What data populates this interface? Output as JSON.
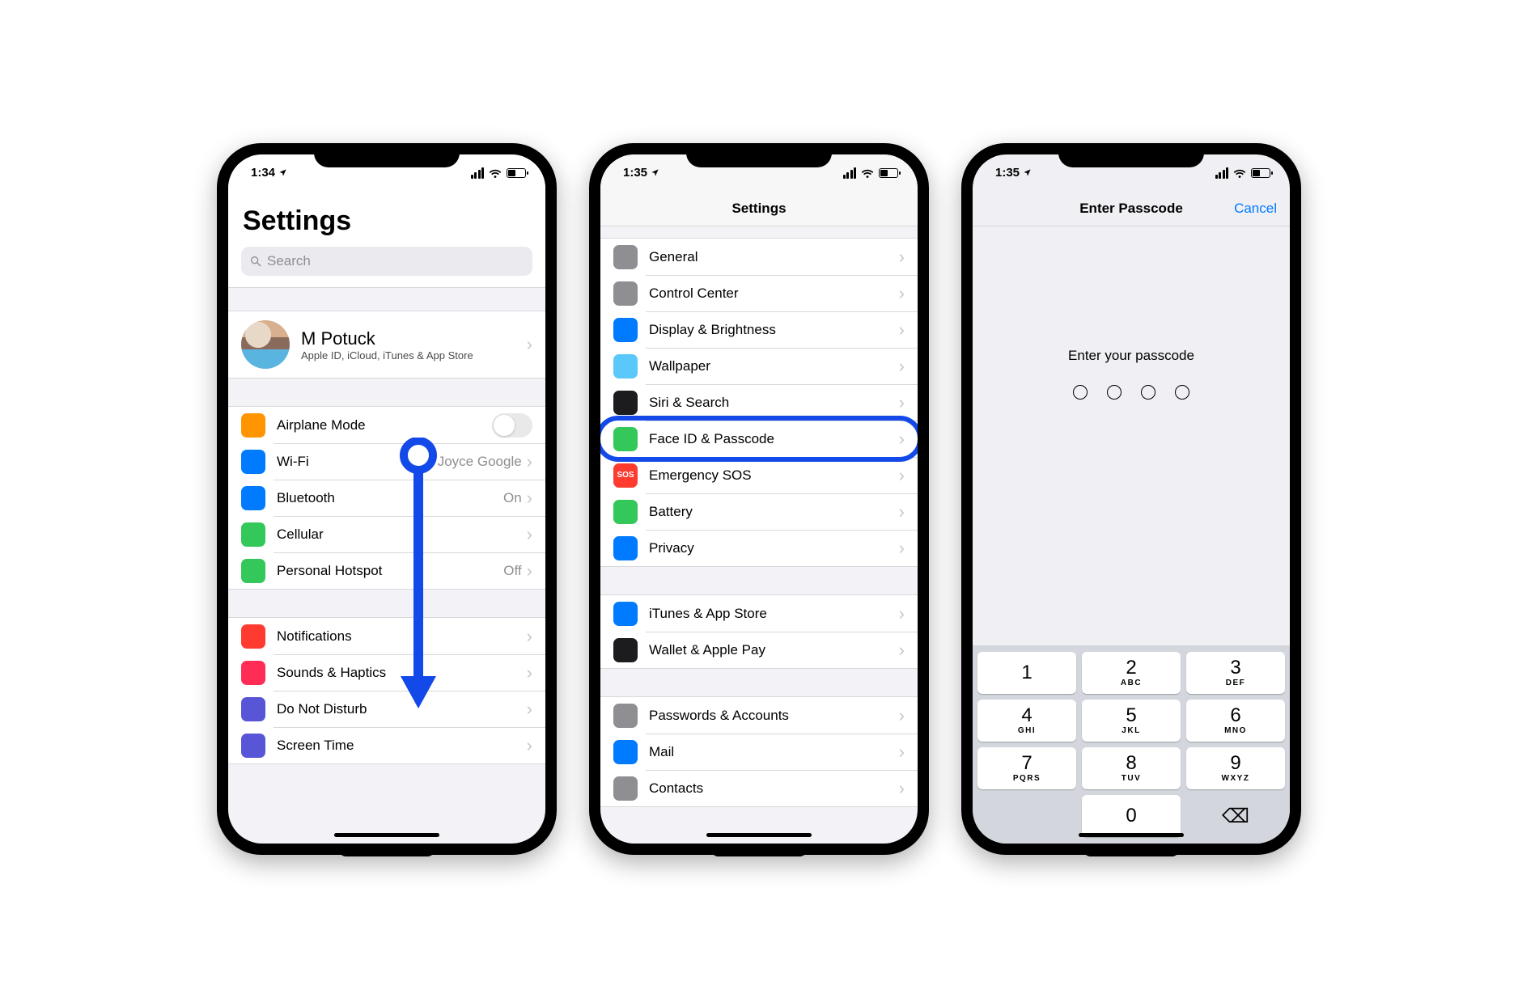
{
  "screen1": {
    "time": "1:34",
    "title": "Settings",
    "search_placeholder": "Search",
    "profile": {
      "name": "M Potuck",
      "subtitle": "Apple ID, iCloud, iTunes & App Store"
    },
    "rows_a": [
      {
        "label": "Airplane Mode",
        "toggle": true,
        "icon": "airplane-icon",
        "color": "ic-orange"
      },
      {
        "label": "Wi-Fi",
        "value": "Joyce Google",
        "icon": "wifi-icon",
        "color": "ic-blue"
      },
      {
        "label": "Bluetooth",
        "value": "On",
        "icon": "bluetooth-icon",
        "color": "ic-blue"
      },
      {
        "label": "Cellular",
        "value": "",
        "icon": "cellular-icon",
        "color": "ic-green"
      },
      {
        "label": "Personal Hotspot",
        "value": "Off",
        "icon": "hotspot-icon",
        "color": "ic-green"
      }
    ],
    "rows_b": [
      {
        "label": "Notifications",
        "icon": "notifications-icon",
        "color": "ic-red"
      },
      {
        "label": "Sounds & Haptics",
        "icon": "sounds-icon",
        "color": "ic-pink"
      },
      {
        "label": "Do Not Disturb",
        "icon": "dnd-icon",
        "color": "ic-purple"
      },
      {
        "label": "Screen Time",
        "icon": "screentime-icon",
        "color": "ic-purple"
      }
    ]
  },
  "screen2": {
    "time": "1:35",
    "title": "Settings",
    "rows_a": [
      {
        "label": "General",
        "icon": "gear-icon",
        "color": "ic-gray"
      },
      {
        "label": "Control Center",
        "icon": "control-center-icon",
        "color": "ic-gray"
      },
      {
        "label": "Display & Brightness",
        "icon": "display-icon",
        "color": "ic-blue"
      },
      {
        "label": "Wallpaper",
        "icon": "wallpaper-icon",
        "color": "ic-lblue"
      },
      {
        "label": "Siri & Search",
        "icon": "siri-icon",
        "color": "ic-dark"
      },
      {
        "label": "Face ID & Passcode",
        "icon": "faceid-icon",
        "color": "ic-green",
        "highlighted": true
      },
      {
        "label": "Emergency SOS",
        "icon": "sos-icon",
        "color": "ic-red",
        "glyph": "SOS"
      },
      {
        "label": "Battery",
        "icon": "battery-icon",
        "color": "ic-green"
      },
      {
        "label": "Privacy",
        "icon": "privacy-icon",
        "color": "ic-blue"
      }
    ],
    "rows_b": [
      {
        "label": "iTunes & App Store",
        "icon": "appstore-icon",
        "color": "ic-blue"
      },
      {
        "label": "Wallet & Apple Pay",
        "icon": "wallet-icon",
        "color": "ic-dark"
      }
    ],
    "rows_c": [
      {
        "label": "Passwords & Accounts",
        "icon": "passwords-icon",
        "color": "ic-key"
      },
      {
        "label": "Mail",
        "icon": "mail-icon",
        "color": "ic-blue"
      },
      {
        "label": "Contacts",
        "icon": "contacts-icon",
        "color": "ic-gray"
      }
    ]
  },
  "screen3": {
    "time": "1:35",
    "title": "Enter Passcode",
    "cancel": "Cancel",
    "prompt": "Enter your passcode",
    "dots": 4,
    "keypad": [
      [
        {
          "n": "1",
          "s": ""
        },
        {
          "n": "2",
          "s": "ABC"
        },
        {
          "n": "3",
          "s": "DEF"
        }
      ],
      [
        {
          "n": "4",
          "s": "GHI"
        },
        {
          "n": "5",
          "s": "JKL"
        },
        {
          "n": "6",
          "s": "MNO"
        }
      ],
      [
        {
          "n": "7",
          "s": "PQRS"
        },
        {
          "n": "8",
          "s": "TUV"
        },
        {
          "n": "9",
          "s": "WXYZ"
        }
      ],
      [
        {
          "blank": true
        },
        {
          "n": "0",
          "s": ""
        },
        {
          "del": true
        }
      ]
    ]
  },
  "annotations": {
    "arrow_color": "#1349e8",
    "highlight_color": "#1349e8"
  }
}
